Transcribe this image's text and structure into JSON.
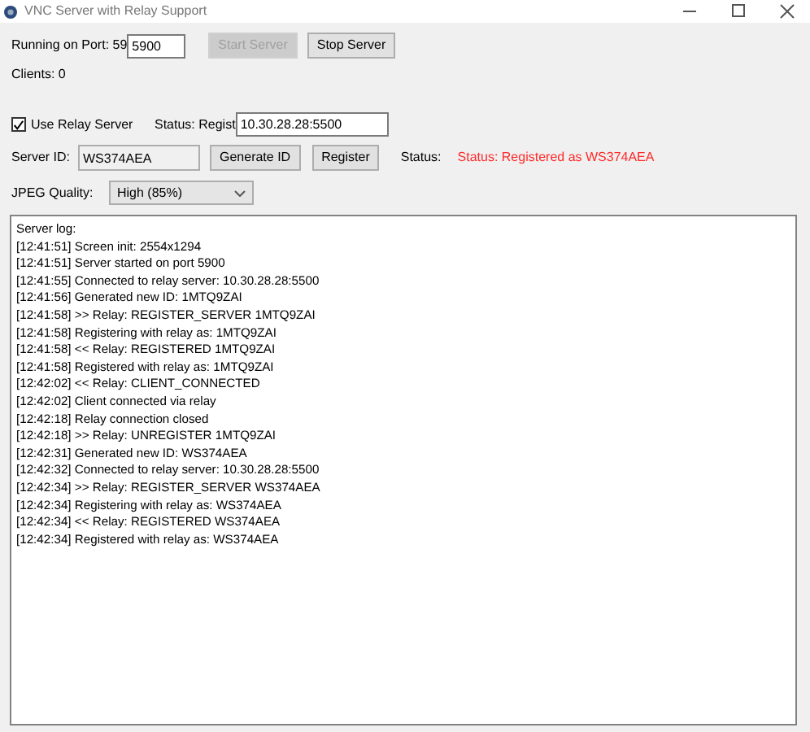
{
  "window": {
    "title": "VNC Server with Relay Support"
  },
  "server": {
    "port_label": "Running on Port: 59",
    "port_value": "5900",
    "buttons": [
      {
        "label": "Start Server",
        "disabled": true
      },
      {
        "label": "Stop Server",
        "disabled": false
      }
    ],
    "clients": "Clients: 0"
  },
  "relay": {
    "use_relay": {
      "label": "Use Relay Server",
      "checked": true
    },
    "status_label": "Status: Regist",
    "address": "10.30.28.28:5500",
    "id_label": "Server ID:",
    "id_value": "WS374AEA",
    "buttons": [
      {
        "label": "Generate ID",
        "disabled": false
      },
      {
        "label": "Register",
        "disabled": false
      }
    ],
    "status_caption": "Status:",
    "status_text": "Status: Registered as WS374AEA"
  },
  "jpeg": {
    "label": "JPEG Quality:",
    "value": "High (85%)"
  },
  "log": [
    "Server log:",
    "[12:41:51] Screen init: 2554x1294",
    "[12:41:51] Server started on port 5900",
    "[12:41:55] Connected to relay server: 10.30.28.28:5500",
    "[12:41:56] Generated new ID: 1MTQ9ZAI",
    "[12:41:58] >> Relay: REGISTER_SERVER 1MTQ9ZAI",
    "[12:41:58] Registering with relay as: 1MTQ9ZAI",
    "[12:41:58] << Relay: REGISTERED 1MTQ9ZAI",
    "[12:41:58] Registered with relay as: 1MTQ9ZAI",
    "[12:42:02] << Relay: CLIENT_CONNECTED",
    "[12:42:02] Client connected via relay",
    "[12:42:18] Relay connection closed",
    "[12:42:18] >> Relay: UNREGISTER 1MTQ9ZAI",
    "[12:42:31] Generated new ID: WS374AEA",
    "[12:42:32] Connected to relay server: 10.30.28.28:5500",
    "[12:42:34] >> Relay: REGISTER_SERVER WS374AEA",
    "[12:42:34] Registering with relay as: WS374AEA",
    "[12:42:34] << Relay: REGISTERED WS374AEA",
    "[12:42:34] Registered with relay as: WS374AEA"
  ]
}
